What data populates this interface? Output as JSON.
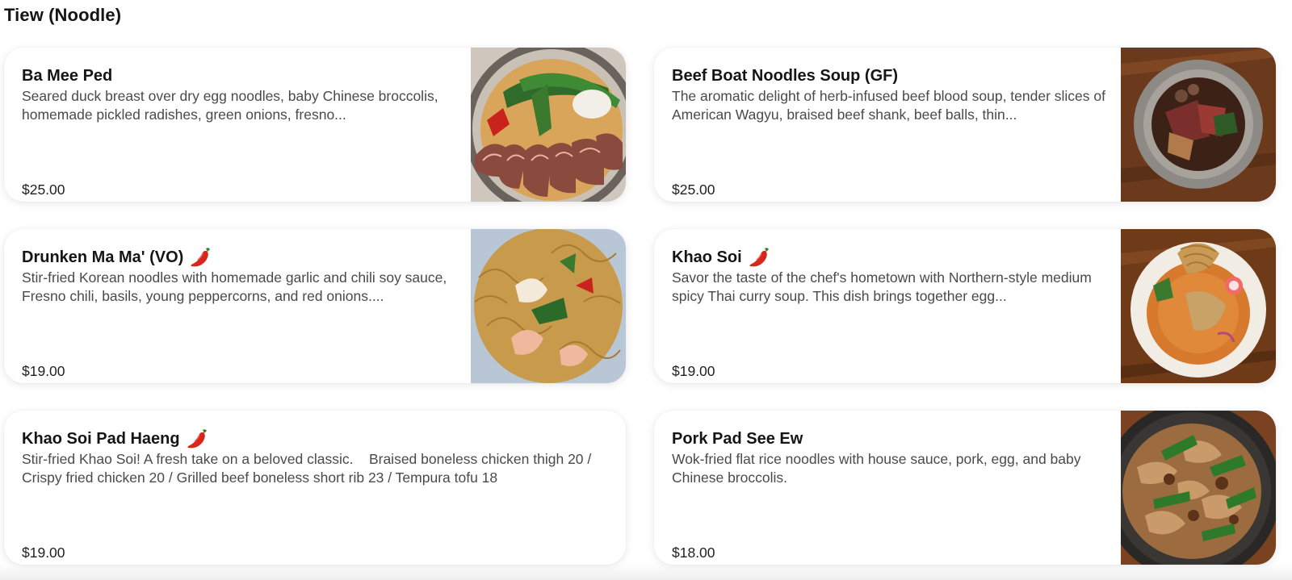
{
  "section": {
    "title": "Tiew (Noodle)"
  },
  "items": [
    {
      "name": "Ba Mee Ped",
      "spicy": false,
      "description": "Seared duck breast over dry egg noodles, baby Chinese broccolis, homemade pickled radishes, green onions, fresno...",
      "price": "$25.00",
      "image": "duck-noodle-bowl"
    },
    {
      "name": "Beef Boat Noodles Soup (GF)",
      "spicy": false,
      "description": "The aromatic delight of herb-infused beef blood soup, tender slices of American Wagyu, braised beef shank, beef balls, thin...",
      "price": "$25.00",
      "image": "beef-soup-bowl"
    },
    {
      "name": "Drunken Ma Ma' (VO)",
      "spicy": true,
      "description": "Stir-fried Korean noodles with homemade garlic and chili soy sauce, Fresno chili, basils, young peppercorns, and red onions....",
      "price": "$19.00",
      "image": "shrimp-noodle-plate"
    },
    {
      "name": "Khao Soi",
      "spicy": true,
      "description": "Savor the taste of the chef's hometown with Northern-style medium spicy Thai curry soup. This dish brings together egg...",
      "price": "$19.00",
      "image": "curry-soup-bowl"
    },
    {
      "name": "Khao Soi Pad Haeng",
      "spicy": true,
      "description": "Stir-fried Khao Soi! A fresh take on a beloved classic.    Braised boneless chicken thigh 20 / Crispy fried chicken 20 / Grilled beef boneless short rib 23 / Tempura tofu 18",
      "price": "$19.00",
      "image": null
    },
    {
      "name": "Pork Pad See Ew",
      "spicy": false,
      "description": "Wok-fried flat rice noodles with house sauce, pork, egg, and baby Chinese broccolis.",
      "price": "$18.00",
      "image": "pad-see-ew-plate"
    }
  ],
  "icons": {
    "spicy": "chili-pepper-icon"
  },
  "colors": {
    "chili": "#d9261c",
    "text": "#151515",
    "muted": "#4a4a4a"
  }
}
